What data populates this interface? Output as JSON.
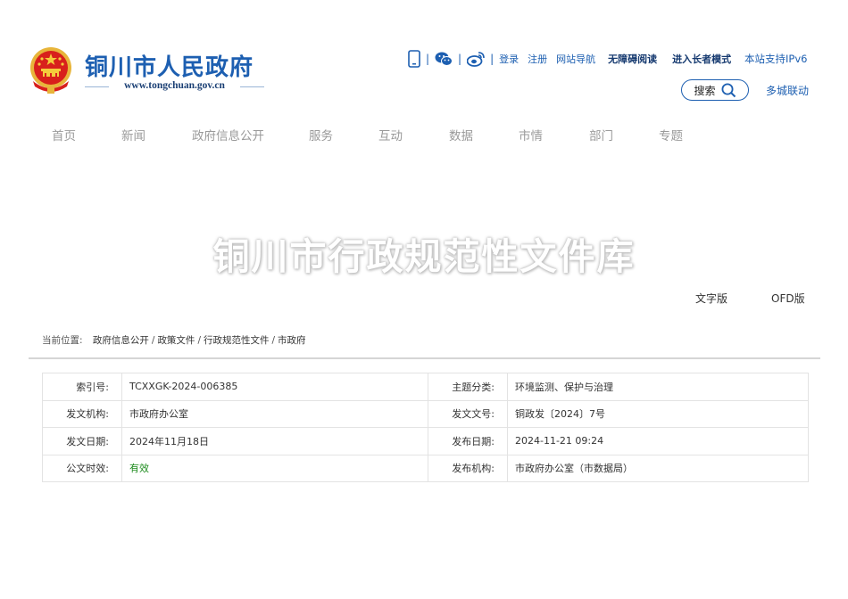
{
  "header": {
    "site_title": "铜川市人民政府",
    "site_url": "www.tongchuan.gov.cn",
    "top_links": {
      "login": "登录",
      "register": "注册",
      "site_nav": "网站导航",
      "accessible": "无障碍阅读",
      "elder_mode": "进入长者模式",
      "ipv6": "本站支持IPv6"
    },
    "icons": [
      "mobile-icon",
      "wechat-icon",
      "weibo-icon"
    ],
    "search_label": "搜索",
    "multi_city": "多城联动"
  },
  "nav": {
    "items": [
      "首页",
      "新闻",
      "政府信息公开",
      "服务",
      "互动",
      "数据",
      "市情",
      "部门",
      "专题"
    ]
  },
  "banner": {
    "title": "铜川市行政规范性文件库",
    "text_version": "文字版",
    "ofd_version": "OFD版"
  },
  "breadcrumb": {
    "label": "当前位置:",
    "items": [
      "政府信息公开",
      "政策文件",
      "行政规范性文件",
      "市政府"
    ]
  },
  "info": {
    "rows": [
      {
        "k1": "索引号:",
        "v1": "TCXXGK-2024-006385",
        "k2": "主题分类:",
        "v2": "环境监测、保护与治理"
      },
      {
        "k1": "发文机构:",
        "v1": "市政府办公室",
        "k2": "发文文号:",
        "v2": "铜政发〔2024〕7号"
      },
      {
        "k1": "发文日期:",
        "v1": "2024年11月18日",
        "k2": "发布日期:",
        "v2": "2024-11-21 09:24"
      },
      {
        "k1": "公文时效:",
        "v1": "有效",
        "k2": "发布机构:",
        "v2": "市政府办公室（市数据局）"
      }
    ]
  },
  "colors": {
    "brand_blue": "#1d5fb1",
    "valid_green": "#1b8a1b",
    "nav_gray": "#9a9a9a"
  }
}
